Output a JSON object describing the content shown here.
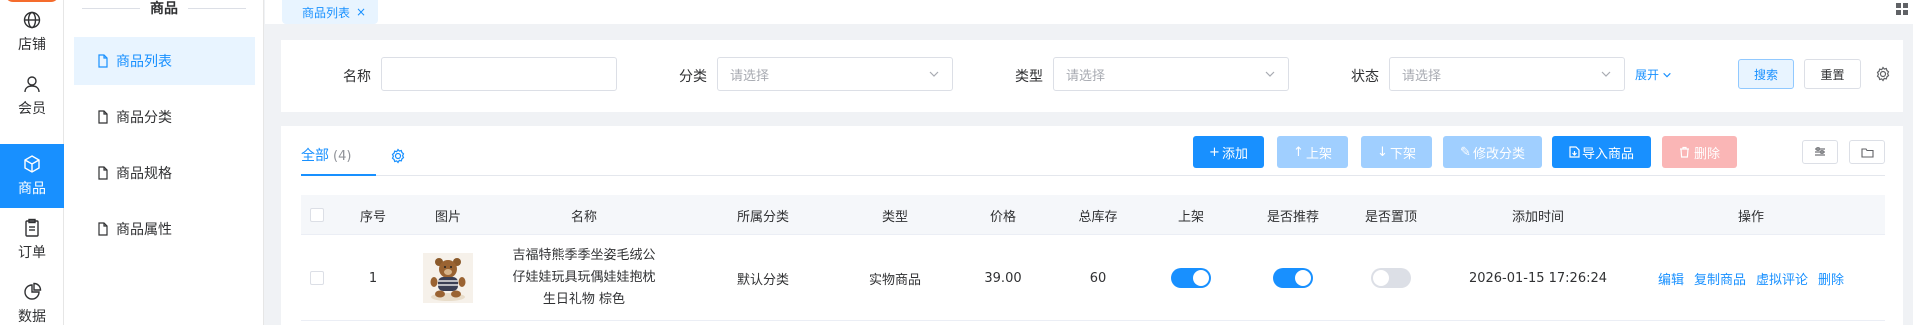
{
  "rail": {
    "items": [
      {
        "label": "店铺",
        "icon": "globe-icon"
      },
      {
        "label": "会员",
        "icon": "user-icon"
      },
      {
        "label": "商品",
        "icon": "box-icon",
        "active": true
      },
      {
        "label": "订单",
        "icon": "clipboard-icon"
      },
      {
        "label": "数据",
        "icon": "pie-chart-icon"
      }
    ]
  },
  "submenu": {
    "title": "商品",
    "items": [
      {
        "label": "商品列表",
        "active": true
      },
      {
        "label": "商品分类"
      },
      {
        "label": "商品规格"
      },
      {
        "label": "商品属性"
      }
    ]
  },
  "tabs": [
    {
      "label": "商品列表",
      "close": "×"
    }
  ],
  "filter": {
    "name_label": "名称",
    "name_value": "",
    "category_label": "分类",
    "category_placeholder": "请选择",
    "type_label": "类型",
    "type_placeholder": "请选择",
    "status_label": "状态",
    "status_placeholder": "请选择",
    "expand_label": "展开",
    "search_label": "搜索",
    "reset_label": "重置"
  },
  "table_tabs": {
    "all_label": "全部",
    "all_count": "(4)"
  },
  "toolbar": {
    "add_label": "添加",
    "on_shelf_label": "上架",
    "off_shelf_label": "下架",
    "change_category_label": "修改分类",
    "import_label": "导入商品",
    "delete_label": "删除"
  },
  "table": {
    "headers": [
      "序号",
      "图片",
      "名称",
      "所属分类",
      "类型",
      "价格",
      "总库存",
      "上架",
      "是否推荐",
      "是否置顶",
      "添加时间",
      "操作"
    ],
    "rows": [
      {
        "index": "1",
        "name_lines": [
          "吉福特熊季季坐姿毛绒公",
          "仔娃娃玩具玩偶娃娃抱枕",
          "生日礼物 棕色"
        ],
        "category": "默认分类",
        "type": "实物商品",
        "price": "39.00",
        "stock": "60",
        "on_shelf": true,
        "recommended": true,
        "pinned": false,
        "added_time": "2026-01-15 17:26:24",
        "actions": [
          "编辑",
          "复制商品",
          "虚拟评论",
          "删除"
        ]
      }
    ]
  },
  "colors": {
    "accent": "#1890ff",
    "accent_light": "#e8f4ff",
    "disabled_primary": "#a0cfff",
    "disabled_danger": "#fab6b6",
    "logo": "#f56c2d"
  }
}
